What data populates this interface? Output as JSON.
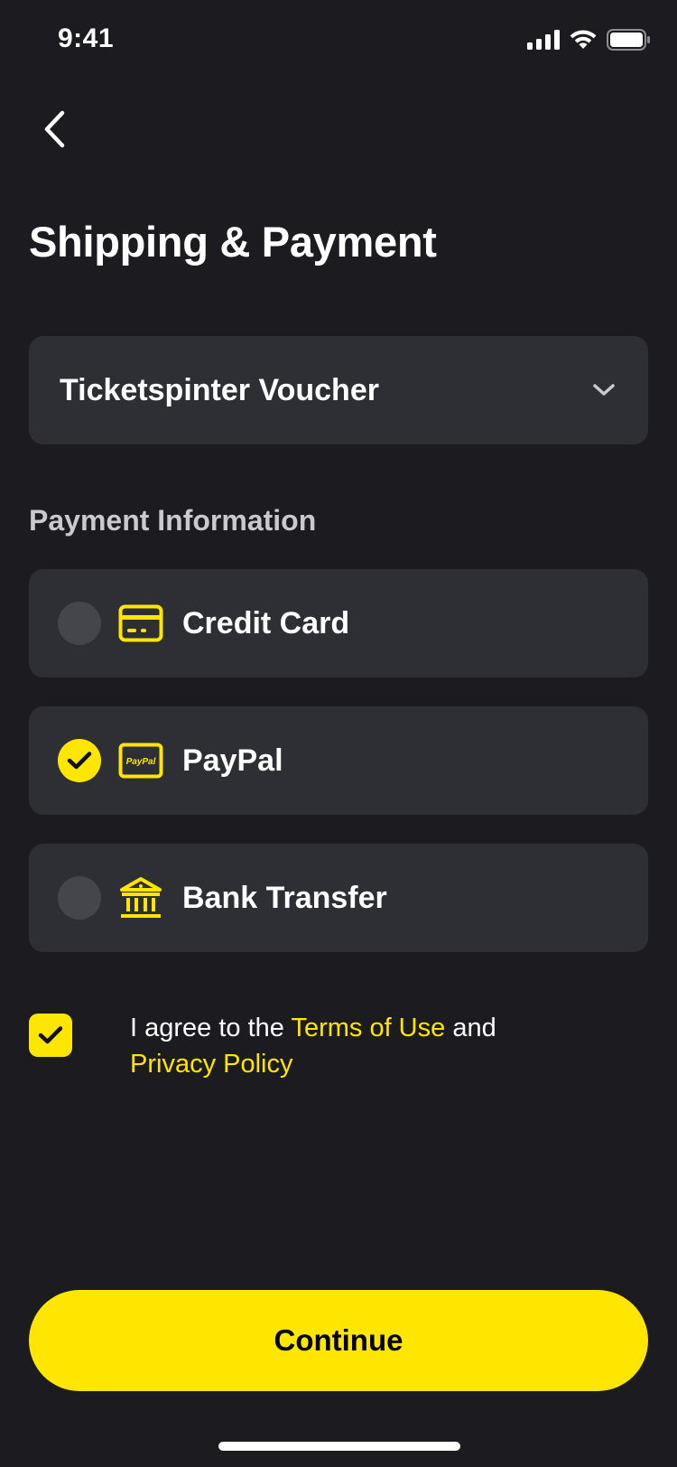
{
  "status_bar": {
    "time": "9:41",
    "icons": [
      "cellular-signal-icon",
      "wifi-icon",
      "battery-icon"
    ]
  },
  "nav": {
    "back_icon": "chevron-left-icon"
  },
  "page": {
    "title": "Shipping & Payment"
  },
  "voucher": {
    "label": "Ticketspinter Voucher",
    "icon": "chevron-down-icon"
  },
  "payment": {
    "section_label": "Payment Information",
    "options": [
      {
        "label": "Credit Card",
        "icon": "credit-card-icon",
        "selected": false
      },
      {
        "label": "PayPal",
        "icon": "paypal-icon",
        "icon_text": "PayPal",
        "selected": true
      },
      {
        "label": "Bank Transfer",
        "icon": "bank-icon",
        "selected": false
      }
    ]
  },
  "agreement": {
    "checked": true,
    "prefix": "I agree to the ",
    "terms_link": "Terms of Use",
    "middle": " and",
    "privacy_link": "Privacy Policy"
  },
  "actions": {
    "continue_label": "Continue"
  },
  "colors": {
    "background": "#1b1b20",
    "surface": "#2e2f35",
    "accent": "#ffe600",
    "radio_off": "#45464c",
    "muted_text": "#c9c9cf"
  }
}
